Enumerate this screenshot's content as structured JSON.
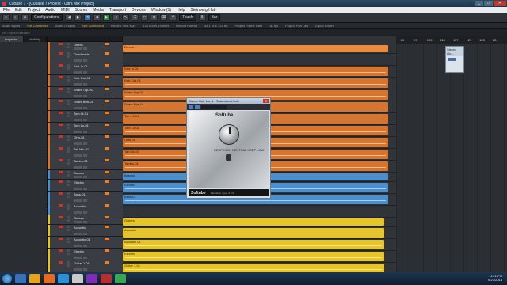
{
  "window": {
    "title": "Cubase 7 - [Cubase 7 Project - Ultra Mix Project]",
    "buttons": {
      "minimize": "_",
      "maximize": "□",
      "close": "✕"
    }
  },
  "menu": [
    "File",
    "Edit",
    "Project",
    "Audio",
    "MIDI",
    "Scores",
    "Media",
    "Transport",
    "Devices",
    "Window (1)",
    "Help",
    "Steinberg Hub"
  ],
  "toolbar": {
    "preset": "Configurations",
    "tool_select": "Touch",
    "snap": "Bar"
  },
  "status": [
    {
      "text": "Audio Inputs",
      "highlight": false
    },
    {
      "text": "Not Connected",
      "highlight": true
    },
    {
      "text": "Audio Outputs",
      "highlight": false
    },
    {
      "text": "Not Connected",
      "highlight": true
    },
    {
      "text": "Record Time Max",
      "highlight": false
    },
    {
      "text": "136 hours 15 mins",
      "highlight": false
    },
    {
      "text": "Record Format",
      "highlight": false
    },
    {
      "text": "44.1 kHz - 24 Bit",
      "highlight": false
    },
    {
      "text": "Project Frame Rate",
      "highlight": false
    },
    {
      "text": "30 fps",
      "highlight": false
    },
    {
      "text": "Project Pan Law",
      "highlight": false
    },
    {
      "text": "Equal Power",
      "highlight": false
    }
  ],
  "info_line": "No Object Selected",
  "inspector": {
    "tabs": [
      "Inspector",
      "Visibility"
    ]
  },
  "ruler": {
    "ticks": [
      "1",
      "5",
      "9",
      "13",
      "17",
      "21",
      "25",
      "29",
      "33",
      "37",
      "41",
      "45",
      "49",
      "53",
      "57",
      "61",
      "65",
      "69",
      "77",
      "81",
      "85",
      "89",
      "97",
      "105",
      "113",
      "117",
      "121",
      "125",
      "129"
    ]
  },
  "tracks": [
    {
      "name": "Drums",
      "type": "folder",
      "clip_label": "Drums"
    },
    {
      "name": "Overheads",
      "type": "audio",
      "clip_label": ""
    },
    {
      "name": "Kick In-01",
      "type": "audio",
      "clip_label": "Kick In-01"
    },
    {
      "name": "Kick Out-01",
      "type": "audio",
      "clip_label": "Kick Out-01"
    },
    {
      "name": "Snare Top-01",
      "type": "audio",
      "clip_label": "Snare Top-01"
    },
    {
      "name": "Snare Btm-01",
      "type": "audio",
      "clip_label": "Snare Btm-01"
    },
    {
      "name": "Tom Hi-01",
      "type": "audio",
      "clip_label": "Tom Hi-01"
    },
    {
      "name": "Tom Lo-01",
      "type": "audio",
      "clip_label": "Tom Lo-01"
    },
    {
      "name": "OHs-01",
      "type": "audio",
      "clip_label": "OHs-01"
    },
    {
      "name": "Tail Mic-01",
      "type": "audio",
      "clip_label": "Tail Mic-01"
    },
    {
      "name": "Tambo-01",
      "type": "audio",
      "clip_label": "Tambo-01"
    },
    {
      "name": "Basses",
      "type": "folder",
      "clip_label": "Basses"
    },
    {
      "name": "Electric",
      "type": "audio",
      "clip_label": "Electric"
    },
    {
      "name": "Bass-01",
      "type": "audio",
      "clip_label": "Bass-01"
    },
    {
      "name": "Acoustic",
      "type": "audio",
      "clip_label": ""
    },
    {
      "name": "Guitars",
      "type": "folder",
      "clip_label": "Guitars"
    },
    {
      "name": "Acoustic",
      "type": "audio",
      "clip_label": "Acoustic"
    },
    {
      "name": "Acoustic-01",
      "type": "audio",
      "clip_label": "Acoustic-01"
    },
    {
      "name": "Electric",
      "type": "audio",
      "clip_label": "Electric"
    },
    {
      "name": "Guitar 1-01",
      "type": "audio",
      "clip_label": "Guitar 1-01"
    }
  ],
  "mini_panel": {
    "title": "Stereo Ou..."
  },
  "plugin": {
    "title": "Stereo Out: Ins. 1 - Saturation Knob",
    "brand": "Softube",
    "labels": "KEEP HIGH  NEUTRAL  KEEP LOW",
    "bottom_brand": "Softube",
    "bottom_text": "Saturation Type: 3.0.0"
  },
  "taskbar": {
    "time": "4:21 PM",
    "date": "6/27/2013"
  },
  "colors": {
    "drums": "#d9742d",
    "bass": "#4b8fcf",
    "guitars": "#e8c527",
    "accent": "#3a6db5"
  }
}
